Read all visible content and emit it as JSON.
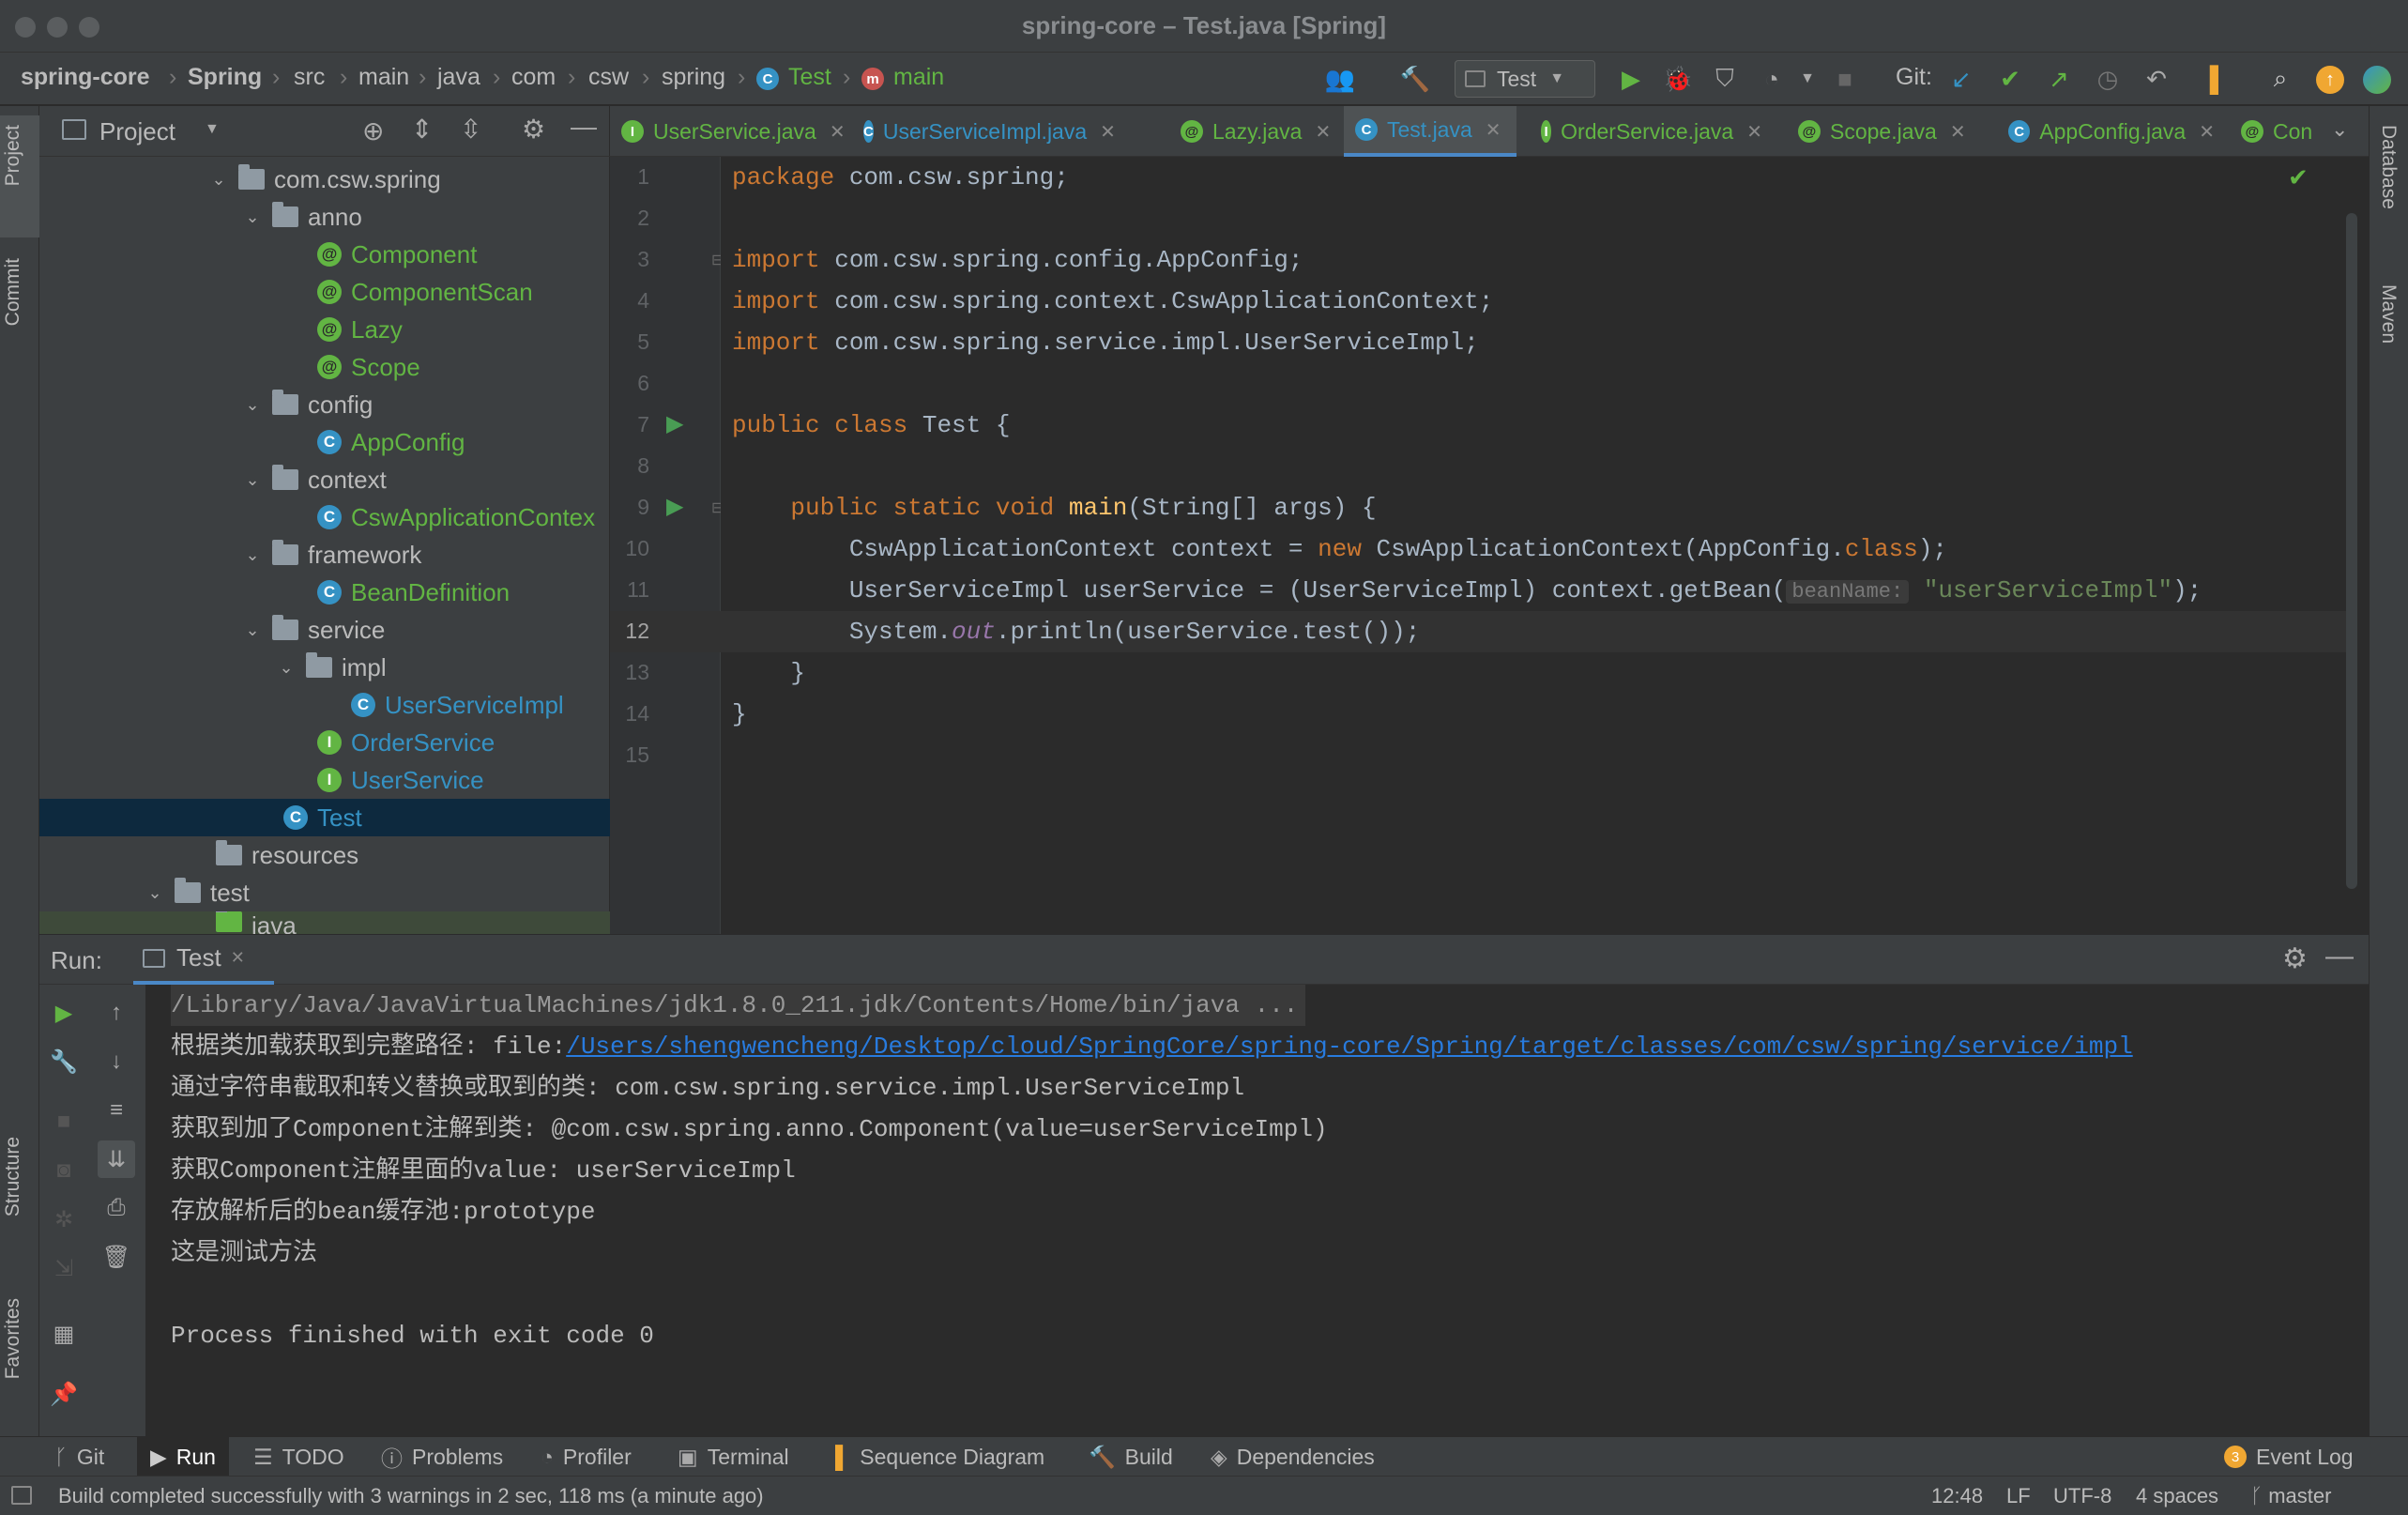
{
  "window": {
    "title": "spring-core – Test.java [Spring]"
  },
  "navbar": {
    "breadcrumbs": [
      "spring-core",
      "Spring",
      "src",
      "main",
      "java",
      "com",
      "csw",
      "spring",
      "Test",
      "main"
    ],
    "run_config": "Test",
    "git_label": "Git:"
  },
  "left_strip": {
    "tabs": [
      "Project",
      "Commit",
      "Structure",
      "Favorites"
    ]
  },
  "right_strip": {
    "tabs": [
      "Database",
      "Maven"
    ]
  },
  "project": {
    "title": "Project",
    "tree": [
      {
        "label": "com.csw.spring",
        "kind": "folder",
        "depth": 0,
        "expanded": true
      },
      {
        "label": "anno",
        "kind": "folder",
        "depth": 1,
        "expanded": true
      },
      {
        "label": "Component",
        "kind": "annotation",
        "depth": 2
      },
      {
        "label": "ComponentScan",
        "kind": "annotation",
        "depth": 2
      },
      {
        "label": "Lazy",
        "kind": "annotation",
        "depth": 2
      },
      {
        "label": "Scope",
        "kind": "annotation",
        "depth": 2
      },
      {
        "label": "config",
        "kind": "folder",
        "depth": 1,
        "expanded": true
      },
      {
        "label": "AppConfig",
        "kind": "class",
        "depth": 2
      },
      {
        "label": "context",
        "kind": "folder",
        "depth": 1,
        "expanded": true
      },
      {
        "label": "CswApplicationContex",
        "kind": "class",
        "depth": 2
      },
      {
        "label": "framework",
        "kind": "folder",
        "depth": 1,
        "expanded": true
      },
      {
        "label": "BeanDefinition",
        "kind": "class",
        "depth": 2
      },
      {
        "label": "service",
        "kind": "folder",
        "depth": 1,
        "expanded": true
      },
      {
        "label": "impl",
        "kind": "folder",
        "depth": 2,
        "expanded": true
      },
      {
        "label": "UserServiceImpl",
        "kind": "class",
        "depth": 3
      },
      {
        "label": "OrderService",
        "kind": "interface",
        "depth": 2
      },
      {
        "label": "UserService",
        "kind": "interface",
        "depth": 2
      },
      {
        "label": "Test",
        "kind": "class-main",
        "depth": 1,
        "selected": true
      },
      {
        "label": "resources",
        "kind": "folder",
        "depth": 0
      },
      {
        "label": "test",
        "kind": "folder",
        "depth": -1,
        "expanded": true
      },
      {
        "label": "java",
        "kind": "folder",
        "depth": 0
      }
    ]
  },
  "editor": {
    "tabs": [
      {
        "label": "UserService.java",
        "icon": "I"
      },
      {
        "label": "UserServiceImpl.java",
        "icon": "C"
      },
      {
        "label": "Lazy.java",
        "icon": "@"
      },
      {
        "label": "Test.java",
        "icon": "C",
        "active": true
      },
      {
        "label": "OrderService.java",
        "icon": "I"
      },
      {
        "label": "Scope.java",
        "icon": "@"
      },
      {
        "label": "AppConfig.java",
        "icon": "C"
      },
      {
        "label": "Con",
        "icon": "@"
      }
    ],
    "line_numbers": [
      "1",
      "2",
      "3",
      "4",
      "5",
      "6",
      "7",
      "8",
      "9",
      "10",
      "11",
      "12",
      "13",
      "14",
      "15"
    ],
    "current_line": "12",
    "code": {
      "l1_kw": "package",
      "l1_rest": " com.csw.spring;",
      "l3_kw": "import",
      "l3_rest": " com.csw.spring.config.AppConfig;",
      "l4_kw": "import",
      "l4_rest": " com.csw.spring.context.CswApplicationContext;",
      "l5_kw": "import",
      "l5_rest": " com.csw.spring.service.impl.UserServiceImpl;",
      "l7_kw": "public class",
      "l7_rest": " Test {",
      "l9_indent": "    ",
      "l9_kw": "public static void",
      "l9_fn": "main",
      "l9_rest": "(String[] args) {",
      "l10_a": "        CswApplicationContext context = ",
      "l10_kw": "new",
      "l10_b": " CswApplicationContext(AppConfig.",
      "l10_kw2": "class",
      "l10_c": ");",
      "l11_a": "        UserServiceImpl userService = (UserServiceImpl) context.getBean(",
      "l11_hint": "beanName:",
      "l11_str": "\"userServiceImpl\"",
      "l11_c": ");",
      "l12_a": "        System.",
      "l12_st": "out",
      "l12_b": ".println(userService.test());",
      "l13": "    }",
      "l14": "}"
    }
  },
  "run": {
    "label": "Run:",
    "tab": "Test",
    "console": {
      "cmd": "/Library/Java/JavaVirtualMachines/jdk1.8.0_211.jdk/Contents/Home/bin/java ...",
      "line2_prefix": "根据类加载获取到完整路径: file:",
      "line2_link": "/Users/shengwencheng/Desktop/cloud/SpringCore/spring-core/Spring/target/classes/com/csw/spring/service/impl",
      "line3": "通过字符串截取和转义替换或取到的类: com.csw.spring.service.impl.UserServiceImpl",
      "line4": "获取到加了Component注解到类: @com.csw.spring.anno.Component(value=userServiceImpl)",
      "line5": "获取Component注解里面的value: userServiceImpl",
      "line6": "存放解析后的bean缓存池:prototype",
      "line7": "这是测试方法",
      "line9": "Process finished with exit code 0"
    }
  },
  "bottom_tools": {
    "git": "Git",
    "run": "Run",
    "todo": "TODO",
    "problems": "Problems",
    "profiler": "Profiler",
    "terminal": "Terminal",
    "sequence": "Sequence Diagram",
    "build": "Build",
    "dependencies": "Dependencies",
    "event_log": "Event Log",
    "event_count": "3"
  },
  "statusbar": {
    "message": "Build completed successfully with 3 warnings in 2 sec, 118 ms (a minute ago)",
    "position": "12:48",
    "line_sep": "LF",
    "encoding": "UTF-8",
    "indent": "4 spaces",
    "branch": "master"
  },
  "colors": {
    "accent_blue": "#3592c4",
    "green": "#62b543",
    "keyword": "#cc7832",
    "string": "#6a8759",
    "function": "#ffc66d"
  }
}
